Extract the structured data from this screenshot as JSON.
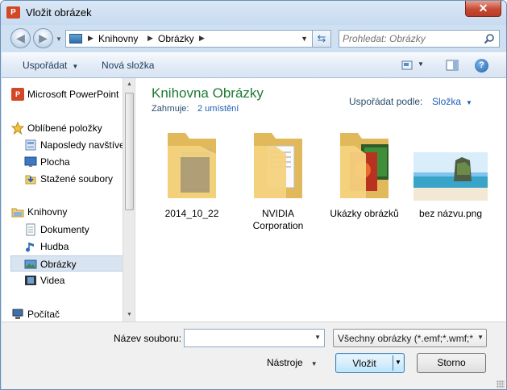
{
  "window": {
    "title": "Vložit obrázek",
    "app_icon": "P",
    "close_glyph": "✕"
  },
  "address": {
    "breadcrumbs": [
      "Knihovny",
      "Obrázky"
    ],
    "search_placeholder": "Prohledat: Obrázky"
  },
  "toolbar": {
    "organize_label": "Uspořádat",
    "new_folder_label": "Nová složka",
    "help_glyph": "?"
  },
  "sidebar": {
    "items": [
      {
        "label": "Microsoft PowerPoint",
        "icon": "powerpoint-icon"
      },
      {
        "label": "Oblíbené položky",
        "icon": "favorites-star-icon"
      },
      {
        "label": "Naposledy navštívená místa",
        "icon": "recent-places-icon"
      },
      {
        "label": "Plocha",
        "icon": "desktop-icon"
      },
      {
        "label": "Stažené soubory",
        "icon": "downloads-icon"
      },
      {
        "label": "Knihovny",
        "icon": "libraries-icon"
      },
      {
        "label": "Dokumenty",
        "icon": "documents-icon"
      },
      {
        "label": "Hudba",
        "icon": "music-icon"
      },
      {
        "label": "Obrázky",
        "icon": "pictures-icon",
        "selected": true
      },
      {
        "label": "Videa",
        "icon": "videos-icon"
      },
      {
        "label": "Počítač",
        "icon": "computer-icon"
      }
    ]
  },
  "library": {
    "title": "Knihovna Obrázky",
    "includes_label": "Zahrnuje:",
    "includes_link": "2 umístění",
    "arrange_label": "Uspořádat podle:",
    "arrange_value": "Složka"
  },
  "items": [
    {
      "label": "2014_10_22",
      "type": "folder"
    },
    {
      "label": "NVIDIA Corporation",
      "type": "folder"
    },
    {
      "label": "Ukázky obrázků",
      "type": "folder"
    },
    {
      "label": "bez názvu.png",
      "type": "image"
    }
  ],
  "footer": {
    "filename_label": "Název souboru:",
    "filename_value": "",
    "filter_value": "Všechny obrázky (*.emf;*.wmf;*",
    "tools_label": "Nástroje",
    "insert_label": "Vložit",
    "cancel_label": "Storno"
  },
  "colors": {
    "library_title": "#1e7a33",
    "link": "#1d5fb4",
    "selected_bg": "#d9e4f1"
  }
}
